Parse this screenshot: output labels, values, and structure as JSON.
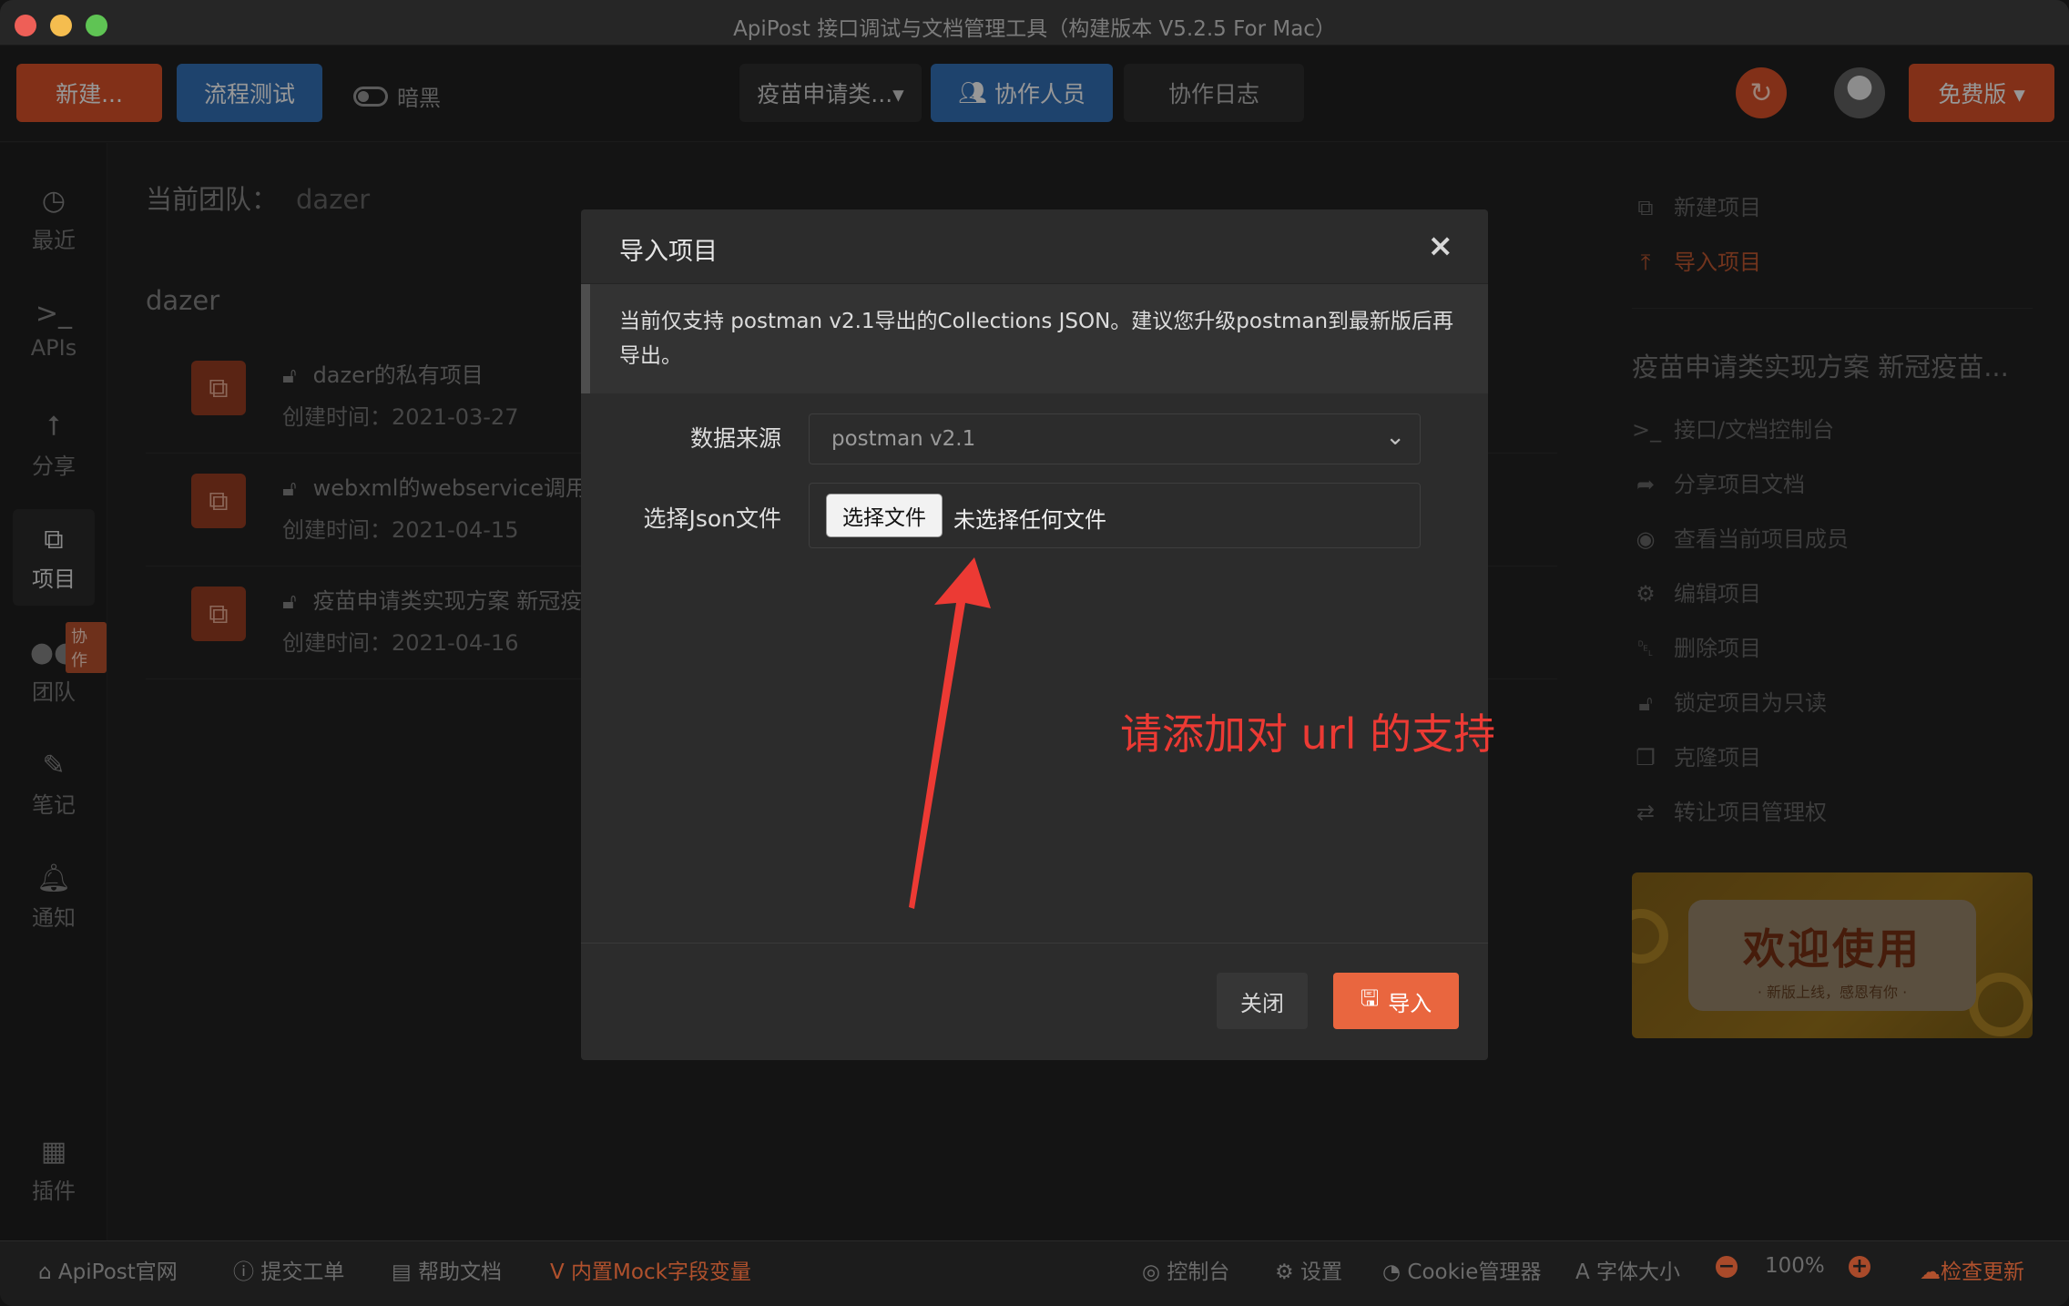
{
  "window": {
    "title": "ApiPost 接口调试与文档管理工具（构建版本 V5.2.5 For Mac）"
  },
  "toolbar": {
    "new_label": "新建...",
    "flow_label": "流程测试",
    "dark_label": "暗黑",
    "project_select": "疫苗申请类...▾",
    "collab_label": "协作人员",
    "log_label": "协作日志",
    "free_label": "免费版 ▾"
  },
  "sidebar": {
    "items": [
      {
        "label": "最近",
        "icon": "clock-icon"
      },
      {
        "label": "APIs",
        "icon": "terminal-icon"
      },
      {
        "label": "分享",
        "icon": "share-icon"
      },
      {
        "label": "项目",
        "icon": "project-icon"
      },
      {
        "label": "团队",
        "icon": "team-icon"
      },
      {
        "label": "笔记",
        "icon": "note-icon"
      },
      {
        "label": "通知",
        "icon": "bell-icon"
      },
      {
        "label": "插件",
        "icon": "plugin-icon"
      }
    ],
    "team_badge": "协作"
  },
  "main": {
    "team_prefix": "当前团队：",
    "team_value": "dazer",
    "team_heading": "dazer",
    "projects": [
      {
        "title": "dazer的私有项目",
        "date": "创建时间：2021-03-27"
      },
      {
        "title": "webxml的webservice调用",
        "date": "创建时间：2021-04-15"
      },
      {
        "title": "疫苗申请类实现方案 新冠疫",
        "date": "创建时间：2021-04-16"
      }
    ]
  },
  "right_panel": {
    "new_project": "新建项目",
    "import_project": "导入项目",
    "project_title": "疫苗申请类实现方案 新冠疫苗...",
    "actions": [
      "接口/文档控制台",
      "分享项目文档",
      "查看当前项目成员",
      "编辑项目",
      "删除项目",
      "锁定项目为只读",
      "克隆项目",
      "转让项目管理权"
    ],
    "banner_big": "欢迎使用",
    "banner_small": "· 新版上线，感恩有你 ·"
  },
  "modal": {
    "title": "导入项目",
    "close_symbol": "×",
    "note": "当前仅支持 postman v2.1导出的Collections JSON。建议您升级postman到最新版后再导出。",
    "source_label": "数据来源",
    "source_value": "postman v2.1",
    "file_label": "选择Json文件",
    "file_button": "选择文件",
    "file_status": "未选择任何文件",
    "annotation": "请添加对 url 的支持",
    "close_button": "关闭",
    "import_button": "导入"
  },
  "statusbar": {
    "site": "ApiPost官网",
    "ticket": "提交工单",
    "help": "帮助文档",
    "mock": "内置Mock字段变量",
    "console": "控制台",
    "settings": "设置",
    "cookie": "Cookie管理器",
    "font": "字体大小",
    "zoom": "100%",
    "update": "检查更新"
  },
  "colors": {
    "accent": "#c84b25",
    "blue": "#2f67a8",
    "annotation": "#ec3a34"
  }
}
